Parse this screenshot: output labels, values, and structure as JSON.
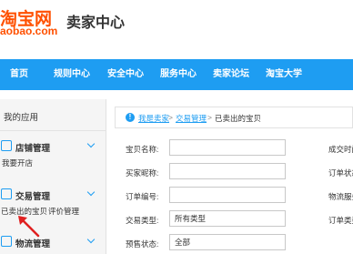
{
  "header": {
    "logo_top": "淘宝网",
    "logo_bottom": "aobao.com",
    "title": "卖家中心"
  },
  "nav": {
    "items": [
      "首页",
      "规则中心",
      "安全中心",
      "服务中心",
      "卖家论坛",
      "淘宝大学"
    ]
  },
  "sidebar": {
    "heading": "我的应用",
    "groups": [
      {
        "title": "店铺管理",
        "icon": "store-icon",
        "links": [
          "我要开店"
        ]
      },
      {
        "title": "交易管理",
        "icon": "trade-icon",
        "links": [
          "已卖出的宝贝",
          "评价管理"
        ]
      },
      {
        "title": "物流管理",
        "icon": "logistics-icon",
        "links": []
      }
    ]
  },
  "breadcrumb": {
    "items": [
      "我是卖家",
      "交易管理",
      "已卖出的宝贝"
    ],
    "separator": ">"
  },
  "form": {
    "item_name_label": "宝贝名称:",
    "buyer_nick_label": "买家昵称:",
    "order_no_label": "订单编号:",
    "trade_type_label": "交易类型:",
    "trade_type_value": "所有类型",
    "presale_label": "预售状态:",
    "presale_value": "全部"
  },
  "right_column": {
    "labels": [
      "成交时间",
      "订单状态",
      "物流服务",
      "订单类型"
    ]
  },
  "colors": {
    "brand_orange": "#ff5000",
    "nav_blue": "#1e9df2",
    "annotation_red": "#e02020"
  }
}
